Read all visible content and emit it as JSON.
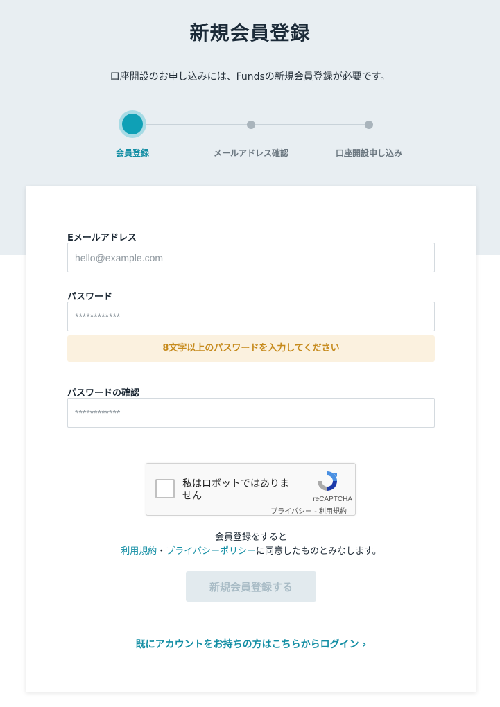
{
  "header": {
    "title": "新規会員登録",
    "subtitle": "口座開設のお申し込みには、Fundsの新規会員登録が必要です。"
  },
  "stepper": {
    "steps": [
      {
        "label": "会員登録",
        "active": true
      },
      {
        "label": "メールアドレス確認",
        "active": false
      },
      {
        "label": "口座開設申し込み",
        "active": false
      }
    ]
  },
  "form": {
    "email": {
      "label": "Eメールアドレス",
      "placeholder": "hello@example.com",
      "value": ""
    },
    "password": {
      "label": "パスワード",
      "placeholder": "************",
      "value": ""
    },
    "password_hint": "8文字以上のパスワードを入力してください",
    "password_confirm": {
      "label": "パスワードの確認",
      "placeholder": "************",
      "value": ""
    }
  },
  "recaptcha": {
    "label": "私はロボットではありません",
    "brand": "reCAPTCHA",
    "privacy": "プライバシー",
    "separator": " - ",
    "terms": "利用規約"
  },
  "terms_notice": {
    "line1": "会員登録をすると",
    "terms_link": "利用規約",
    "dot": "・",
    "privacy_link": "プライバシーポリシー",
    "suffix": "に同意したものとみなします。"
  },
  "submit_label": "新規会員登録する",
  "login_link": "既にアカウントをお持ちの方はこちらからログイン ›",
  "colors": {
    "accent": "#138ea4",
    "active_step": "#0fa0b6",
    "hint_bg": "#fbf1df",
    "hint_text": "#c68a1c",
    "top_bg": "#e8eef2"
  }
}
